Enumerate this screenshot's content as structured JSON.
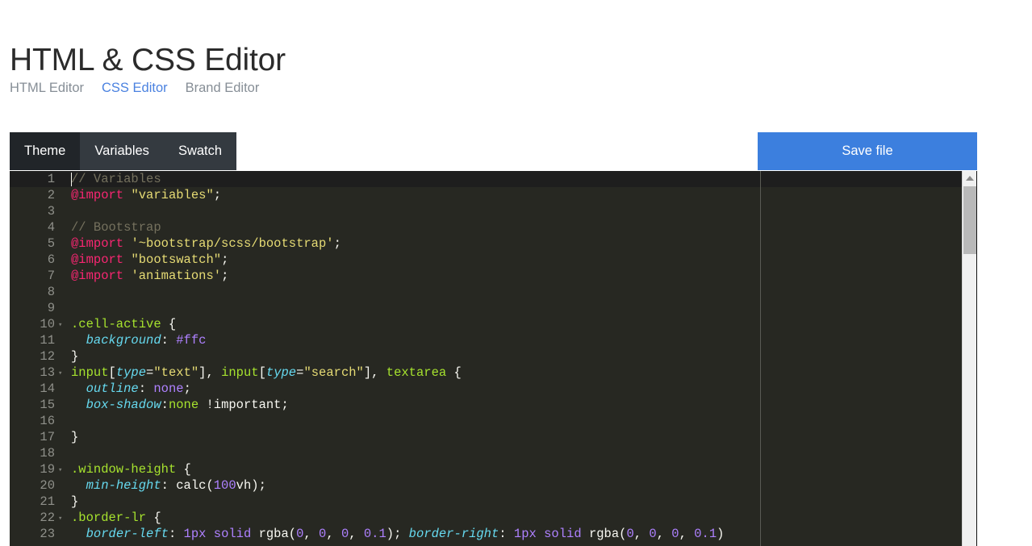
{
  "page": {
    "title": "HTML & CSS Editor"
  },
  "nav": {
    "links": [
      {
        "label": "HTML Editor",
        "active": false
      },
      {
        "label": "CSS Editor",
        "active": true
      },
      {
        "label": "Brand Editor",
        "active": false
      }
    ]
  },
  "toolbar": {
    "tabs": [
      {
        "label": "Theme",
        "active": true
      },
      {
        "label": "Variables",
        "active": false
      },
      {
        "label": "Swatch",
        "active": false
      }
    ],
    "save_label": "Save file"
  },
  "colors": {
    "accent_link": "#4b82e0",
    "save_button": "#3c7fde",
    "tabbar_bg": "#343a40",
    "tab_active_bg": "#212529",
    "editor_bg": "#272822",
    "active_line_bg": "#1e1e1e",
    "gutter_text": "#8f908a",
    "token_comment": "#75715e",
    "token_keyword": "#f92672",
    "token_string": "#e6db74",
    "token_selector": "#a6e22e",
    "token_property": "#66d9ef",
    "token_number": "#ae81ff",
    "token_default": "#f8f8f2"
  },
  "editor": {
    "language": "scss",
    "caret_line": 1,
    "print_margin_column": 80,
    "scrollbar": {
      "up_arrow_icon": "triangle-up-icon",
      "thumb_position_percent": 4,
      "thumb_size_percent": 18
    },
    "lines": [
      {
        "n": "1",
        "fold": "",
        "tokens": [
          {
            "c": "t-com",
            "t": "// Variables"
          }
        ]
      },
      {
        "n": "2",
        "fold": "",
        "tokens": [
          {
            "c": "t-key",
            "t": "@import"
          },
          {
            "c": "t-def",
            "t": " "
          },
          {
            "c": "t-str",
            "t": "\"variables\""
          },
          {
            "c": "t-punc",
            "t": ";"
          }
        ]
      },
      {
        "n": "3",
        "fold": "",
        "tokens": []
      },
      {
        "n": "4",
        "fold": "",
        "tokens": [
          {
            "c": "t-com",
            "t": "// Bootstrap"
          }
        ]
      },
      {
        "n": "5",
        "fold": "",
        "tokens": [
          {
            "c": "t-key",
            "t": "@import"
          },
          {
            "c": "t-def",
            "t": " "
          },
          {
            "c": "t-str",
            "t": "'~bootstrap/scss/bootstrap'"
          },
          {
            "c": "t-punc",
            "t": ";"
          }
        ]
      },
      {
        "n": "6",
        "fold": "",
        "tokens": [
          {
            "c": "t-key",
            "t": "@import"
          },
          {
            "c": "t-def",
            "t": " "
          },
          {
            "c": "t-str",
            "t": "\"bootswatch\""
          },
          {
            "c": "t-punc",
            "t": ";"
          }
        ]
      },
      {
        "n": "7",
        "fold": "",
        "tokens": [
          {
            "c": "t-key",
            "t": "@import"
          },
          {
            "c": "t-def",
            "t": " "
          },
          {
            "c": "t-str",
            "t": "'animations'"
          },
          {
            "c": "t-punc",
            "t": ";"
          }
        ]
      },
      {
        "n": "8",
        "fold": "",
        "tokens": []
      },
      {
        "n": "9",
        "fold": "",
        "tokens": []
      },
      {
        "n": "10",
        "fold": "▾",
        "tokens": [
          {
            "c": "t-sel",
            "t": ".cell-active"
          },
          {
            "c": "t-punc",
            "t": " {"
          }
        ]
      },
      {
        "n": "11",
        "fold": "",
        "tokens": [
          {
            "c": "t-def",
            "t": "  "
          },
          {
            "c": "t-prop",
            "t": "background"
          },
          {
            "c": "t-punc",
            "t": ": "
          },
          {
            "c": "t-num",
            "t": "#ffc"
          }
        ]
      },
      {
        "n": "12",
        "fold": "",
        "tokens": [
          {
            "c": "t-punc",
            "t": "}"
          }
        ]
      },
      {
        "n": "13",
        "fold": "▾",
        "tokens": [
          {
            "c": "t-sel",
            "t": "input"
          },
          {
            "c": "t-punc",
            "t": "["
          },
          {
            "c": "t-prop",
            "t": "type"
          },
          {
            "c": "t-punc",
            "t": "="
          },
          {
            "c": "t-str",
            "t": "\"text\""
          },
          {
            "c": "t-punc",
            "t": "], "
          },
          {
            "c": "t-sel",
            "t": "input"
          },
          {
            "c": "t-punc",
            "t": "["
          },
          {
            "c": "t-prop",
            "t": "type"
          },
          {
            "c": "t-punc",
            "t": "="
          },
          {
            "c": "t-str",
            "t": "\"search\""
          },
          {
            "c": "t-punc",
            "t": "], "
          },
          {
            "c": "t-sel",
            "t": "textarea"
          },
          {
            "c": "t-punc",
            "t": " {"
          }
        ]
      },
      {
        "n": "14",
        "fold": "",
        "tokens": [
          {
            "c": "t-def",
            "t": "  "
          },
          {
            "c": "t-prop",
            "t": "outline"
          },
          {
            "c": "t-punc",
            "t": ": "
          },
          {
            "c": "t-num",
            "t": "none"
          },
          {
            "c": "t-punc",
            "t": ";"
          }
        ]
      },
      {
        "n": "15",
        "fold": "",
        "tokens": [
          {
            "c": "t-def",
            "t": "  "
          },
          {
            "c": "t-prop",
            "t": "box-shadow"
          },
          {
            "c": "t-punc",
            "t": ":"
          },
          {
            "c": "t-fn",
            "t": "none"
          },
          {
            "c": "t-def",
            "t": " "
          },
          {
            "c": "t-def",
            "t": "!important"
          },
          {
            "c": "t-punc",
            "t": ";"
          }
        ]
      },
      {
        "n": "16",
        "fold": "",
        "tokens": []
      },
      {
        "n": "17",
        "fold": "",
        "tokens": [
          {
            "c": "t-punc",
            "t": "}"
          }
        ]
      },
      {
        "n": "18",
        "fold": "",
        "tokens": []
      },
      {
        "n": "19",
        "fold": "▾",
        "tokens": [
          {
            "c": "t-sel",
            "t": ".window-height"
          },
          {
            "c": "t-punc",
            "t": " {"
          }
        ]
      },
      {
        "n": "20",
        "fold": "",
        "tokens": [
          {
            "c": "t-def",
            "t": "  "
          },
          {
            "c": "t-prop",
            "t": "min-height"
          },
          {
            "c": "t-punc",
            "t": ": "
          },
          {
            "c": "t-def",
            "t": "calc("
          },
          {
            "c": "t-num",
            "t": "100"
          },
          {
            "c": "t-def",
            "t": "vh"
          },
          {
            "c": "t-punc",
            "t": ");"
          }
        ]
      },
      {
        "n": "21",
        "fold": "",
        "tokens": [
          {
            "c": "t-punc",
            "t": "}"
          }
        ]
      },
      {
        "n": "22",
        "fold": "▾",
        "tokens": [
          {
            "c": "t-sel",
            "t": ".border-lr"
          },
          {
            "c": "t-punc",
            "t": " {"
          }
        ]
      },
      {
        "n": "23",
        "fold": "",
        "tokens": [
          {
            "c": "t-def",
            "t": "  "
          },
          {
            "c": "t-prop",
            "t": "border-left"
          },
          {
            "c": "t-punc",
            "t": ": "
          },
          {
            "c": "t-num",
            "t": "1px"
          },
          {
            "c": "t-def",
            "t": " "
          },
          {
            "c": "t-num",
            "t": "solid"
          },
          {
            "c": "t-def",
            "t": " rgba("
          },
          {
            "c": "t-num",
            "t": "0"
          },
          {
            "c": "t-def",
            "t": ", "
          },
          {
            "c": "t-num",
            "t": "0"
          },
          {
            "c": "t-def",
            "t": ", "
          },
          {
            "c": "t-num",
            "t": "0"
          },
          {
            "c": "t-def",
            "t": ", "
          },
          {
            "c": "t-num",
            "t": "0.1"
          },
          {
            "c": "t-punc",
            "t": "); "
          },
          {
            "c": "t-prop",
            "t": "border-right"
          },
          {
            "c": "t-punc",
            "t": ": "
          },
          {
            "c": "t-num",
            "t": "1px"
          },
          {
            "c": "t-def",
            "t": " "
          },
          {
            "c": "t-num",
            "t": "solid"
          },
          {
            "c": "t-def",
            "t": " rgba("
          },
          {
            "c": "t-num",
            "t": "0"
          },
          {
            "c": "t-def",
            "t": ", "
          },
          {
            "c": "t-num",
            "t": "0"
          },
          {
            "c": "t-def",
            "t": ", "
          },
          {
            "c": "t-num",
            "t": "0"
          },
          {
            "c": "t-def",
            "t": ", "
          },
          {
            "c": "t-num",
            "t": "0.1"
          },
          {
            "c": "t-punc",
            "t": ")"
          }
        ]
      }
    ]
  }
}
